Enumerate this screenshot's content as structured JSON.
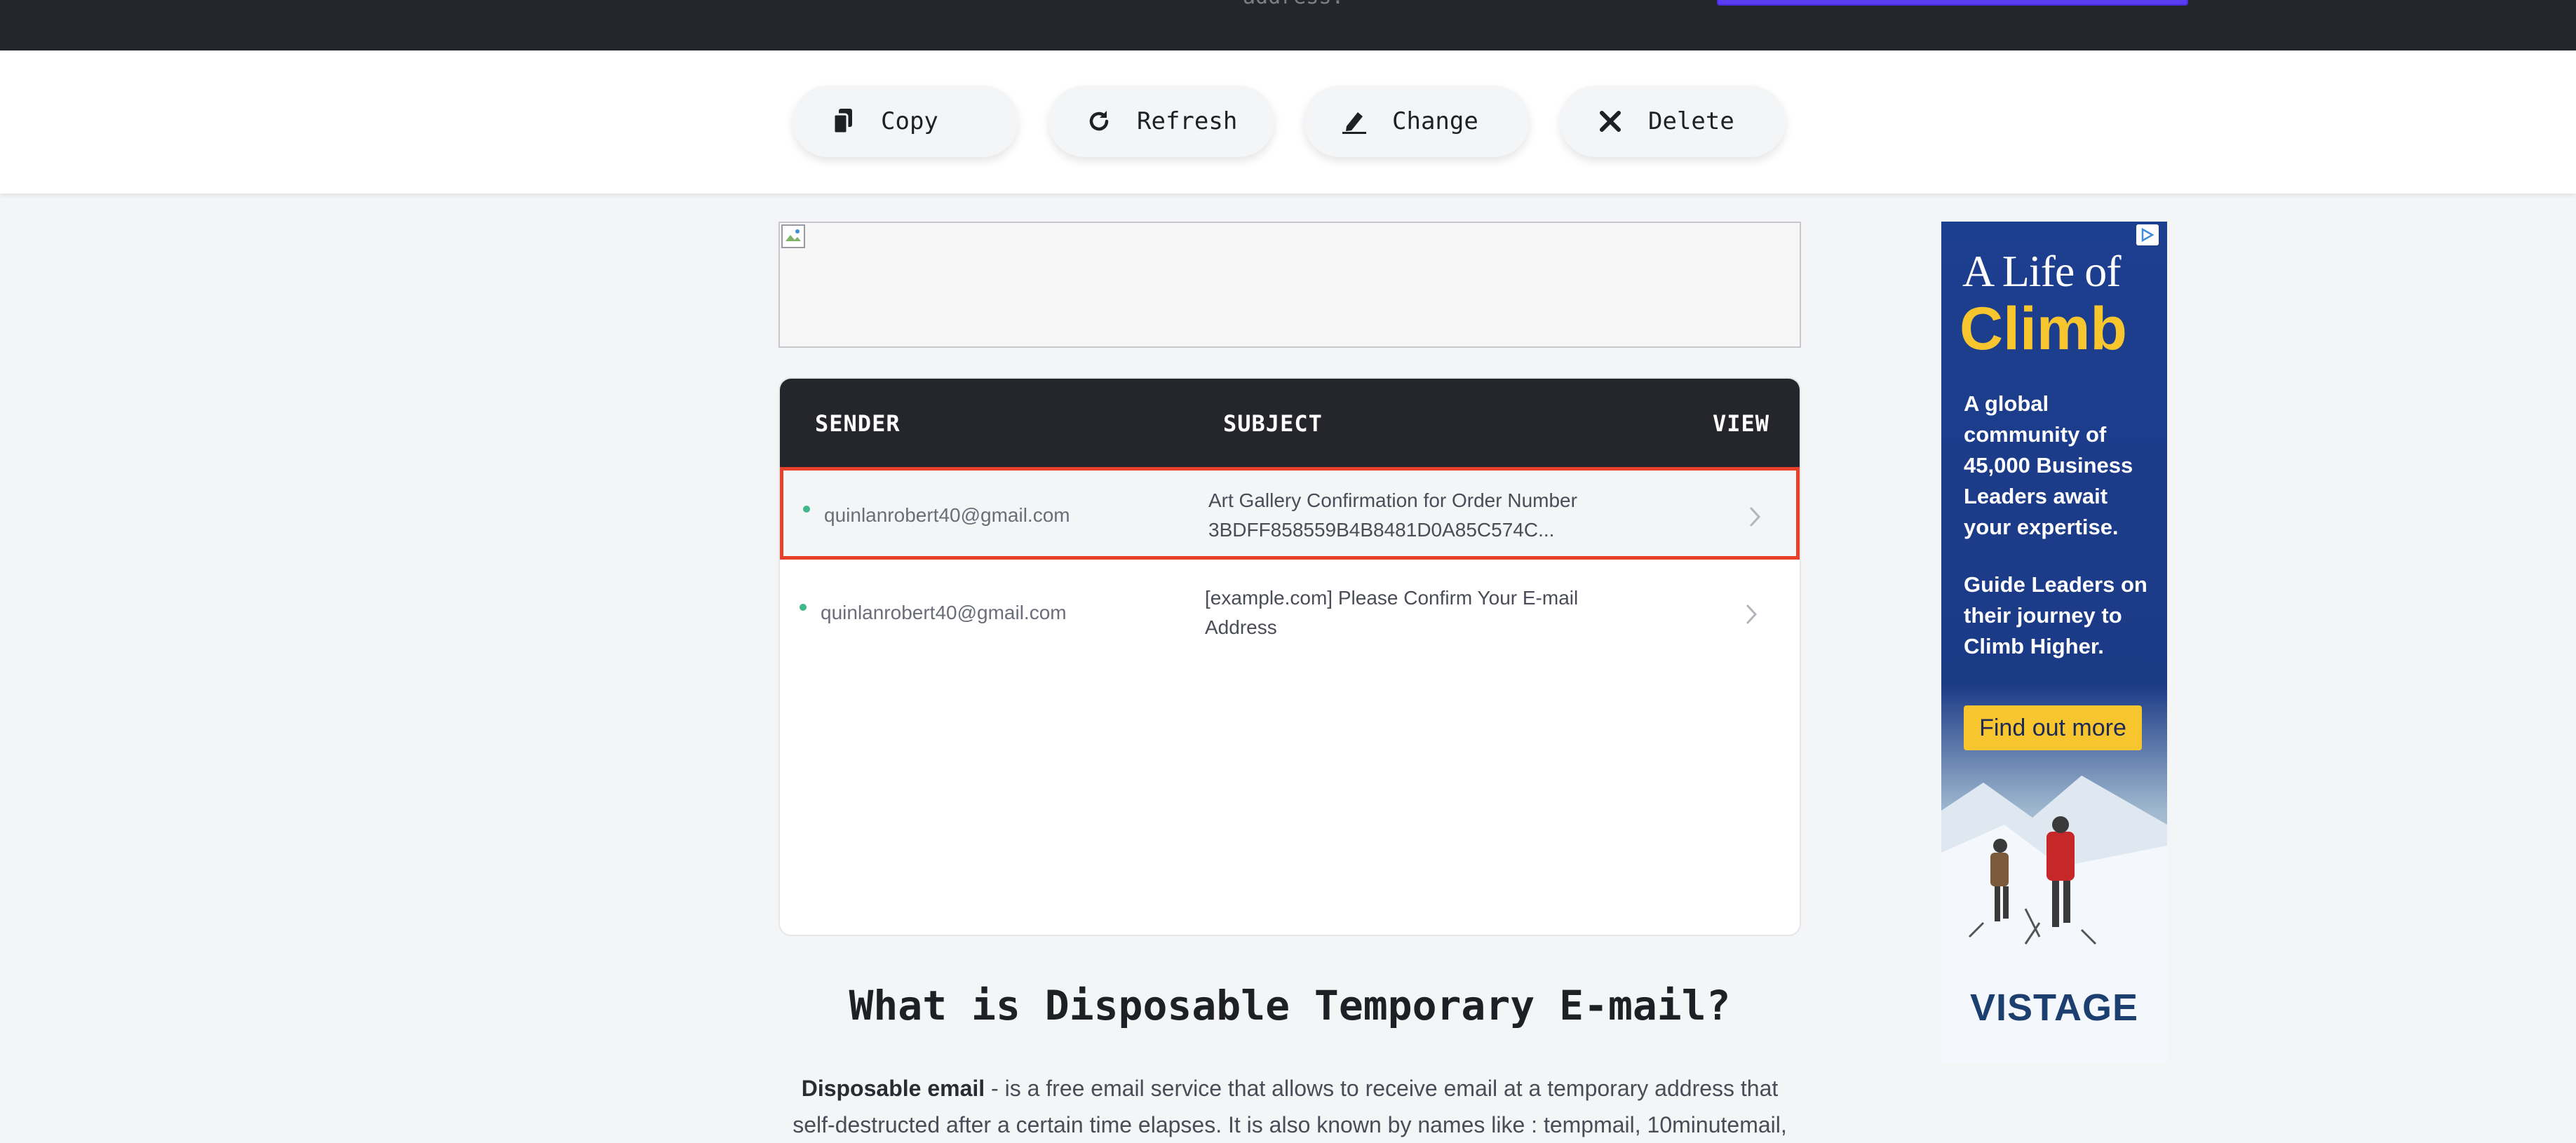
{
  "topbar": {
    "partial_text": "address."
  },
  "actions": [
    {
      "label": "Copy",
      "icon": "copy-icon"
    },
    {
      "label": "Refresh",
      "icon": "refresh-icon"
    },
    {
      "label": "Change",
      "icon": "edit-icon"
    },
    {
      "label": "Delete",
      "icon": "close-icon"
    }
  ],
  "inbox": {
    "headers": {
      "sender": "SENDER",
      "subject": "SUBJECT",
      "view": "VIEW"
    },
    "rows": [
      {
        "sender": "quinlanrobert40@gmail.com",
        "subject_line1": "Art Gallery Confirmation for Order Number",
        "subject_line2": "3BDFF858559B4B8481D0A85C574C...",
        "selected": true
      },
      {
        "sender": "quinlanrobert40@gmail.com",
        "subject_line1": "[example.com] Please Confirm Your E-mail",
        "subject_line2": "Address",
        "selected": false
      }
    ]
  },
  "side_ad": {
    "headline1": "A Life of",
    "headline2": "Climb",
    "body1": "A global community of 45,000 Business Leaders await your expertise.",
    "body2": "Guide Leaders on their journey to Climb Higher.",
    "cta": "Find out more",
    "brand": "VISTAGE"
  },
  "content": {
    "title": "What is Disposable Temporary E-mail?",
    "para_bold": "Disposable email",
    "para_rest": " - is a free email service that allows to receive email at a temporary address that self-destructed after a certain time elapses. It is also known by names like : tempmail, 10minutemail,"
  },
  "colors": {
    "dark": "#25262c",
    "accent_selected": "#e8402a",
    "unread_dot": "#3fb88a",
    "ad_blue": "#1d3f8f",
    "ad_yellow": "#f7c62f"
  }
}
